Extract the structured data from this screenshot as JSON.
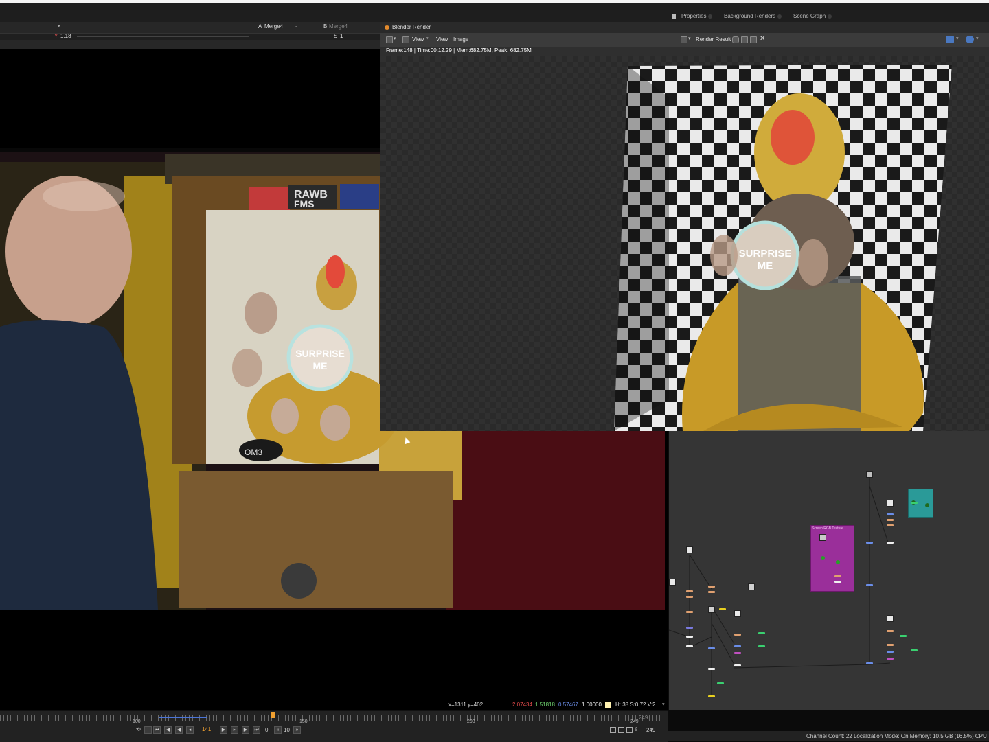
{
  "topbar": {
    "tabs": [
      "Properties",
      "Background Renders",
      "Scene Graph"
    ]
  },
  "viewer": {
    "input_a_label": "A",
    "input_a_value": "Merge4",
    "input_a_layer": "-",
    "input_b_label": "B",
    "input_b_value": "Merge4",
    "gain_label": "Y",
    "gain_value": "1.18",
    "s_label": "S",
    "s_value": "1",
    "pixel_info": {
      "coords": "x=1311 y=402",
      "r": "2.07434",
      "g": "1.51818",
      "b": "0.57467",
      "a": "1.00000",
      "hsv": "H: 38 S:0.72 V:2."
    }
  },
  "blender": {
    "title": "Blender Render",
    "menu": [
      "View",
      "View",
      "Image"
    ],
    "image_name": "Render Result",
    "stats": "Frame:148 | Time:00:12.29 | Mem:682.75M, Peak: 682.75M"
  },
  "timeline": {
    "ticks": [
      "100",
      "150",
      "200",
      "249"
    ],
    "current_frame": "141",
    "step": "10",
    "frame_counter": "0",
    "end_frame": "249",
    "end_frame_2": "249"
  },
  "nodegraph": {
    "backdrop_label": "Screen RGB Texture"
  },
  "statusbar": {
    "text": "Channel Count: 22 Localization Mode: On Memory: 10.5 GB (16.5%) CPU"
  },
  "footage": {
    "button_text_1": "SURPRISE",
    "button_text_2": "ME",
    "signs": [
      "RAWB",
      "FMS",
      "OM3"
    ]
  },
  "colors": {
    "accent_orange": "#f0a030",
    "r_color": "#e04a4a",
    "g_color": "#6fd36f",
    "b_color": "#6a8de8",
    "node_purple": "#9a2f9a",
    "node_teal": "#2a9a98"
  }
}
